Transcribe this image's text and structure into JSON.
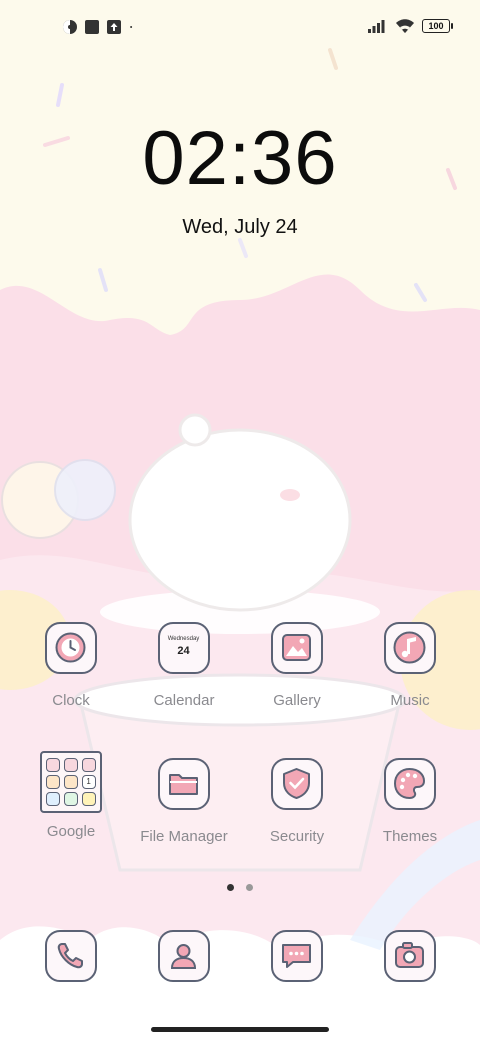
{
  "status_bar": {
    "left_icons": [
      "pie-chart-icon",
      "square-icon",
      "upload-icon",
      "dot-icon"
    ],
    "signal_icon": "signal-icon",
    "wifi_icon": "wifi-icon",
    "battery": "100"
  },
  "lockscreen": {
    "time": "02:36",
    "date": "Wed, July 24"
  },
  "home": {
    "row1": [
      {
        "label": "Clock",
        "icon": "clock-icon"
      },
      {
        "label": "Calendar",
        "icon": "calendar-icon",
        "icon_text_top": "Wednesday",
        "icon_text_day": "24"
      },
      {
        "label": "Gallery",
        "icon": "gallery-icon"
      },
      {
        "label": "Music",
        "icon": "music-icon"
      }
    ],
    "row2": [
      {
        "label": "Google",
        "icon": "google-folder"
      },
      {
        "label": "File Manager",
        "icon": "folder-icon"
      },
      {
        "label": "Security",
        "icon": "shield-icon"
      },
      {
        "label": "Themes",
        "icon": "palette-icon"
      }
    ],
    "folder_badge": "1",
    "page_indicator": {
      "pages": 2,
      "active": 1
    },
    "dock": [
      {
        "icon": "phone-icon"
      },
      {
        "icon": "contacts-icon"
      },
      {
        "icon": "messages-icon"
      },
      {
        "icon": "camera-icon"
      }
    ]
  },
  "colors": {
    "icon_outline": "#5b6275",
    "icon_accent": "#f2a7b5",
    "label": "#8a8a8f"
  }
}
